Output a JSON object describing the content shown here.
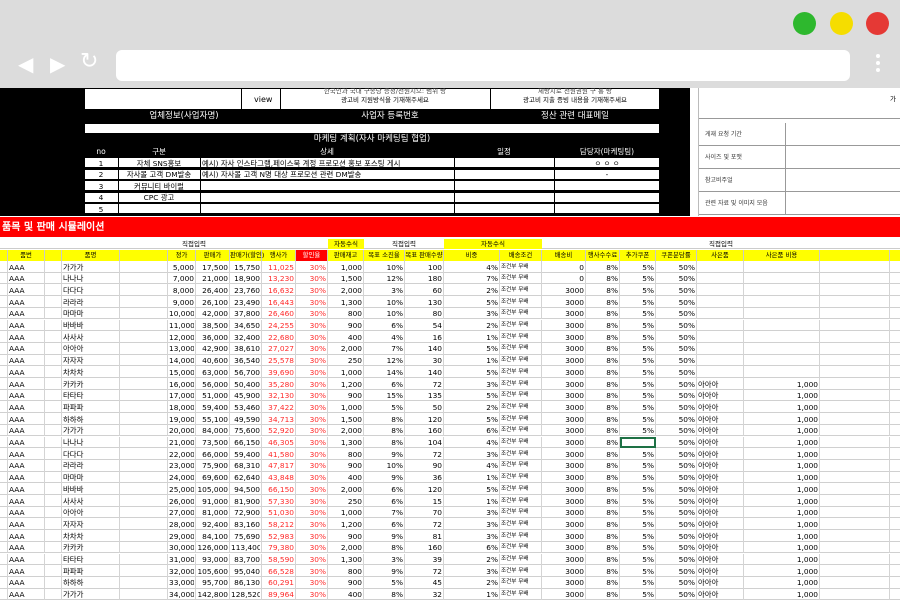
{
  "window": {
    "controls": [
      {
        "name": "green",
        "color": "#2eb82e"
      },
      {
        "name": "yellow",
        "color": "#f5dd00"
      },
      {
        "name": "red",
        "color": "#e53935"
      }
    ],
    "url": ""
  },
  "top": {
    "view_label": "view",
    "note1_line1": "한국인과 국내 구종당 증정/전원지으: 범위 방",
    "note1_line2": "광고비 지원방식을 기재해주세요",
    "note2_line1": "제방지로 전원권원 구 통 방",
    "note2_line2": "광고비 지출 증빙 내용을 기재해주세요",
    "ga_label": "가",
    "bar_headers": [
      "업체정보(사업자명)",
      "사업자 등록번호",
      "정산 관련 대표메일"
    ],
    "plan_title": "마케팅 계획(자사 마케팅팀 협업)"
  },
  "plan": {
    "headers": [
      "no",
      "구분",
      "상세",
      "일정",
      "담당자(마케팅팀)"
    ],
    "rows": [
      {
        "no": "1",
        "type": "자체 SNS홍보",
        "detail": "예시) 자사 인스타그램,페이스북 계정 프로모션 홍보 포스팅 게시",
        "schedule": "",
        "owner": "ㅇ ㅇ ㅇ"
      },
      {
        "no": "2",
        "type": "자사몰 고객 DM발송",
        "detail": "예시) 자사몰 고객 N명 대상 프로모션 관련 DM발송",
        "schedule": "",
        "owner": "-"
      },
      {
        "no": "3",
        "type": "커뮤니티 바이럴",
        "detail": "",
        "schedule": "",
        "owner": ""
      },
      {
        "no": "4",
        "type": "CPC 광고",
        "detail": "",
        "schedule": "",
        "owner": ""
      },
      {
        "no": "5",
        "type": "",
        "detail": "",
        "schedule": "",
        "owner": ""
      }
    ]
  },
  "side_panel": {
    "items": [
      "게재 요청 기간",
      "사이즈 및 포맷",
      "참고비주얼",
      "관련 자료 및 이미지 모음"
    ]
  },
  "sim": {
    "title": "품목 및 판매 시뮬레이션",
    "group_headers": {
      "direct_input_1": "직접입력",
      "auto_1": "자동수식",
      "direct_input_2": "직접입력",
      "auto_2": "자동수식",
      "direct_input_3": "직접입력"
    },
    "columns": [
      "",
      "품번",
      "",
      "품명",
      "",
      "정가",
      "판매가",
      "판매가(할인)",
      "행사가",
      "할인율",
      "판매재고",
      "목표 소진율",
      "목표 판매수량",
      "비중",
      "배송조건",
      "배송비",
      "행사수수료",
      "추가쿠폰",
      "쿠폰분담률",
      "사은품",
      "사은품 비용",
      ""
    ],
    "rows": [
      [
        "AAA",
        "가가가",
        "5,000",
        "17,500",
        "15,750",
        "11,025",
        "30%",
        "1,000",
        "10%",
        "100",
        "4%",
        "조건부 무배",
        "0",
        "8%",
        "5%",
        "50%",
        "",
        ""
      ],
      [
        "AAA",
        "나나나",
        "7,000",
        "21,000",
        "18,900",
        "13,230",
        "30%",
        "1,500",
        "12%",
        "180",
        "7%",
        "조건부 무배",
        "0",
        "8%",
        "5%",
        "50%",
        "",
        ""
      ],
      [
        "AAA",
        "다다다",
        "8,000",
        "26,400",
        "23,760",
        "16,632",
        "30%",
        "2,000",
        "3%",
        "60",
        "2%",
        "조건부 무배",
        "3000",
        "8%",
        "5%",
        "50%",
        "",
        ""
      ],
      [
        "AAA",
        "라라라",
        "9,000",
        "26,100",
        "23,490",
        "16,443",
        "30%",
        "1,300",
        "10%",
        "130",
        "5%",
        "조건부 무배",
        "3000",
        "8%",
        "5%",
        "50%",
        "",
        ""
      ],
      [
        "AAA",
        "마마마",
        "10,000",
        "42,000",
        "37,800",
        "26,460",
        "30%",
        "800",
        "10%",
        "80",
        "3%",
        "조건부 무배",
        "3000",
        "8%",
        "5%",
        "50%",
        "",
        ""
      ],
      [
        "AAA",
        "바바바",
        "11,000",
        "38,500",
        "34,650",
        "24,255",
        "30%",
        "900",
        "6%",
        "54",
        "2%",
        "조건부 무배",
        "3000",
        "8%",
        "5%",
        "50%",
        "",
        ""
      ],
      [
        "AAA",
        "사사사",
        "12,000",
        "36,000",
        "32,400",
        "22,680",
        "30%",
        "400",
        "4%",
        "16",
        "1%",
        "조건부 무배",
        "3000",
        "8%",
        "5%",
        "50%",
        "",
        ""
      ],
      [
        "AAA",
        "아아아",
        "13,000",
        "42,900",
        "38,610",
        "27,027",
        "30%",
        "2,000",
        "7%",
        "140",
        "5%",
        "조건부 무배",
        "3000",
        "8%",
        "5%",
        "50%",
        "",
        ""
      ],
      [
        "AAA",
        "자자자",
        "14,000",
        "40,600",
        "36,540",
        "25,578",
        "30%",
        "250",
        "12%",
        "30",
        "1%",
        "조건부 무배",
        "3000",
        "8%",
        "5%",
        "50%",
        "",
        ""
      ],
      [
        "AAA",
        "차차차",
        "15,000",
        "63,000",
        "56,700",
        "39,690",
        "30%",
        "1,000",
        "14%",
        "140",
        "5%",
        "조건부 무배",
        "3000",
        "8%",
        "5%",
        "50%",
        "",
        ""
      ],
      [
        "AAA",
        "카카카",
        "16,000",
        "56,000",
        "50,400",
        "35,280",
        "30%",
        "1,200",
        "6%",
        "72",
        "3%",
        "조건부 무배",
        "3000",
        "8%",
        "5%",
        "50%",
        "아아아",
        "1,000"
      ],
      [
        "AAA",
        "타타타",
        "17,000",
        "51,000",
        "45,900",
        "32,130",
        "30%",
        "900",
        "15%",
        "135",
        "5%",
        "조건부 무배",
        "3000",
        "8%",
        "5%",
        "50%",
        "아아아",
        "1,000"
      ],
      [
        "AAA",
        "파파파",
        "18,000",
        "59,400",
        "53,460",
        "37,422",
        "30%",
        "1,000",
        "5%",
        "50",
        "2%",
        "조건부 무배",
        "3000",
        "8%",
        "5%",
        "50%",
        "아아아",
        "1,000"
      ],
      [
        "AAA",
        "하하하",
        "19,000",
        "55,100",
        "49,590",
        "34,713",
        "30%",
        "1,500",
        "8%",
        "120",
        "5%",
        "조건부 무배",
        "3000",
        "8%",
        "5%",
        "50%",
        "아아아",
        "1,000"
      ],
      [
        "AAA",
        "가가가",
        "20,000",
        "84,000",
        "75,600",
        "52,920",
        "30%",
        "2,000",
        "8%",
        "160",
        "6%",
        "조건부 무배",
        "3000",
        "8%",
        "5%",
        "50%",
        "아아아",
        "1,000"
      ],
      [
        "AAA",
        "나나나",
        "21,000",
        "73,500",
        "66,150",
        "46,305",
        "30%",
        "1,300",
        "8%",
        "104",
        "4%",
        "조건부 무배",
        "3000",
        "8%",
        "",
        "50%",
        "아아아",
        "1,000"
      ],
      [
        "AAA",
        "다다다",
        "22,000",
        "66,000",
        "59,400",
        "41,580",
        "30%",
        "800",
        "9%",
        "72",
        "3%",
        "조건부 무배",
        "3000",
        "8%",
        "5%",
        "50%",
        "아아아",
        "1,000"
      ],
      [
        "AAA",
        "라라라",
        "23,000",
        "75,900",
        "68,310",
        "47,817",
        "30%",
        "900",
        "10%",
        "90",
        "4%",
        "조건부 무배",
        "3000",
        "8%",
        "5%",
        "50%",
        "아아아",
        "1,000"
      ],
      [
        "AAA",
        "마마마",
        "24,000",
        "69,600",
        "62,640",
        "43,848",
        "30%",
        "400",
        "9%",
        "36",
        "1%",
        "조건부 무배",
        "3000",
        "8%",
        "5%",
        "50%",
        "아아아",
        "1,000"
      ],
      [
        "AAA",
        "바바바",
        "25,000",
        "105,000",
        "94,500",
        "66,150",
        "30%",
        "2,000",
        "6%",
        "120",
        "5%",
        "조건부 무배",
        "3000",
        "8%",
        "5%",
        "50%",
        "아아아",
        "1,000"
      ],
      [
        "AAA",
        "사사사",
        "26,000",
        "91,000",
        "81,900",
        "57,330",
        "30%",
        "250",
        "6%",
        "15",
        "1%",
        "조건부 무배",
        "3000",
        "8%",
        "5%",
        "50%",
        "아아아",
        "1,000"
      ],
      [
        "AAA",
        "아아아",
        "27,000",
        "81,000",
        "72,900",
        "51,030",
        "30%",
        "1,000",
        "7%",
        "70",
        "3%",
        "조건부 무배",
        "3000",
        "8%",
        "5%",
        "50%",
        "아아아",
        "1,000"
      ],
      [
        "AAA",
        "자자자",
        "28,000",
        "92,400",
        "83,160",
        "58,212",
        "30%",
        "1,200",
        "6%",
        "72",
        "3%",
        "조건부 무배",
        "3000",
        "8%",
        "5%",
        "50%",
        "아아아",
        "1,000"
      ],
      [
        "AAA",
        "차차차",
        "29,000",
        "84,100",
        "75,690",
        "52,983",
        "30%",
        "900",
        "9%",
        "81",
        "3%",
        "조건부 무배",
        "3000",
        "8%",
        "5%",
        "50%",
        "아아아",
        "1,000"
      ],
      [
        "AAA",
        "카카카",
        "30,000",
        "126,000",
        "113,400",
        "79,380",
        "30%",
        "2,000",
        "8%",
        "160",
        "6%",
        "조건부 무배",
        "3000",
        "8%",
        "5%",
        "50%",
        "아아아",
        "1,000"
      ],
      [
        "AAA",
        "타타타",
        "31,000",
        "93,000",
        "83,700",
        "58,590",
        "30%",
        "1,300",
        "3%",
        "39",
        "2%",
        "조건부 무배",
        "3000",
        "8%",
        "5%",
        "50%",
        "아아아",
        "1,000"
      ],
      [
        "AAA",
        "파파파",
        "32,000",
        "105,600",
        "95,040",
        "66,528",
        "30%",
        "800",
        "9%",
        "72",
        "3%",
        "조건부 무배",
        "3000",
        "8%",
        "5%",
        "50%",
        "아아아",
        "1,000"
      ],
      [
        "AAA",
        "하하하",
        "33,000",
        "95,700",
        "86,130",
        "60,291",
        "30%",
        "900",
        "5%",
        "45",
        "2%",
        "조건부 무배",
        "3000",
        "8%",
        "5%",
        "50%",
        "아아아",
        "1,000"
      ],
      [
        "AAA",
        "가가가",
        "34,000",
        "142,800",
        "128,520",
        "89,964",
        "30%",
        "400",
        "8%",
        "32",
        "1%",
        "조건부 무배",
        "3000",
        "8%",
        "5%",
        "50%",
        "아아아",
        "1,000"
      ]
    ]
  }
}
